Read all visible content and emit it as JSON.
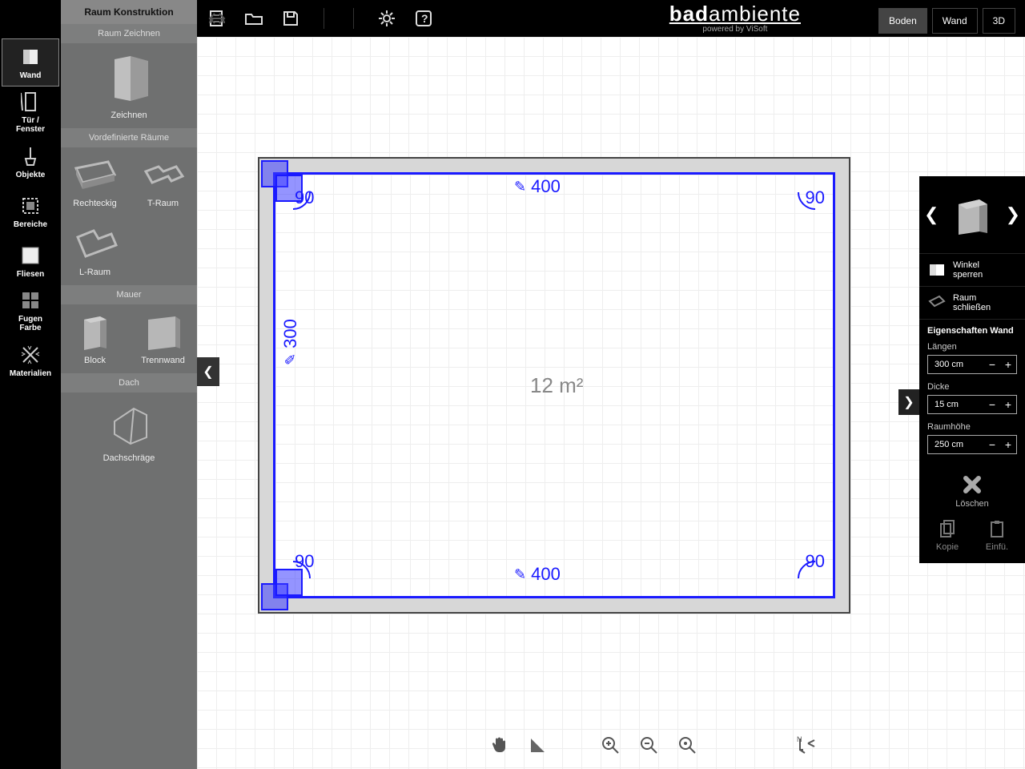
{
  "brand": {
    "main_bold": "bad",
    "main_rest": "ambiente",
    "sub": "powered by ViSoft"
  },
  "view_tabs": [
    "Boden",
    "Wand",
    "3D"
  ],
  "view_active": 0,
  "rail": [
    {
      "id": "wand",
      "label": "Wand"
    },
    {
      "id": "tuer",
      "label": "Tür /\nFenster"
    },
    {
      "id": "objekte",
      "label": "Objekte"
    },
    {
      "id": "bereiche",
      "label": "Bereiche"
    },
    {
      "id": "fliesen",
      "label": "Fliesen"
    },
    {
      "id": "fugen",
      "label": "Fugen\nFarbe"
    },
    {
      "id": "materialien",
      "label": "Materialien"
    }
  ],
  "rail_active": 0,
  "tools": {
    "header": "Raum Konstruktion",
    "s1": {
      "title": "Raum Zeichnen",
      "items": [
        "Zeichnen"
      ]
    },
    "s2": {
      "title": "Vordefinierte Räume",
      "items": [
        "Rechteckig",
        "T-Raum",
        "L-Raum"
      ]
    },
    "s3": {
      "title": "Mauer",
      "items": [
        "Block",
        "Trennwand"
      ]
    },
    "s4": {
      "title": "Dach",
      "items": [
        "Dachschräge"
      ]
    }
  },
  "room": {
    "area": "12 m²",
    "dim_top": "400",
    "dim_bottom": "400",
    "dim_left": "300",
    "ang_tl": "90",
    "ang_tr": "90",
    "ang_bl": "90",
    "ang_br": "90"
  },
  "rpanel": {
    "opt1": "Winkel\nsperren",
    "opt2": "Raum\nschließen",
    "props_title": "Eigenschaften Wand",
    "f1": {
      "label": "Längen",
      "value": "300 cm"
    },
    "f2": {
      "label": "Dicke",
      "value": "15 cm"
    },
    "f3": {
      "label": "Raumhöhe",
      "value": "250 cm"
    },
    "delete": "Löschen",
    "copy": "Kopie",
    "paste": "Einfü."
  }
}
